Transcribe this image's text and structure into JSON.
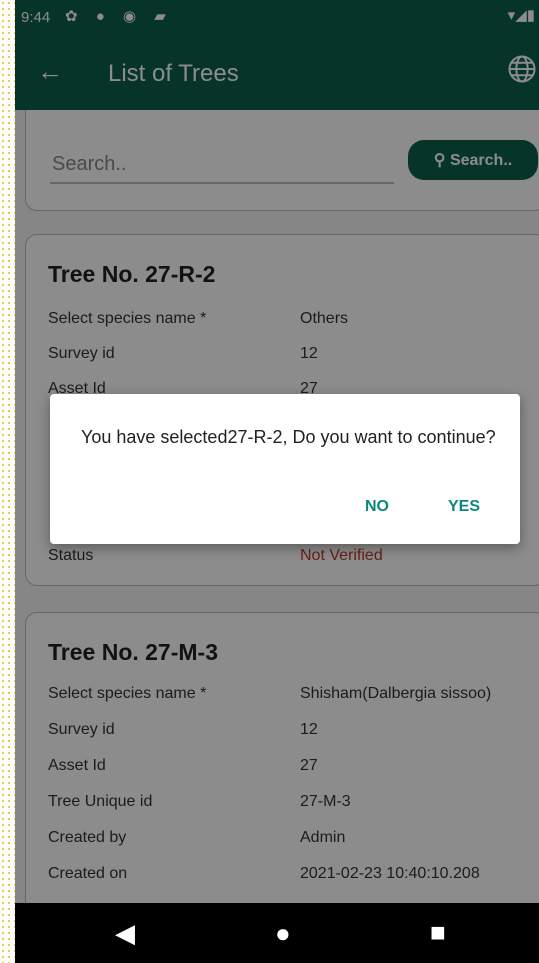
{
  "status_bar": {
    "time": "9:44",
    "icons": "✿ ● ◉ ▰",
    "right_icons": "▾◢▮"
  },
  "app_bar": {
    "back_icon": "←",
    "title": "List of Trees",
    "globe_icon": "globe-icon"
  },
  "search": {
    "placeholder": "Search..",
    "button_label": "Search.."
  },
  "cards": [
    {
      "title": "Tree No. 27-R-2",
      "rows": [
        {
          "key": "Select species name *",
          "value": "Others"
        },
        {
          "key": "Survey id",
          "value": "12"
        },
        {
          "key": "Asset Id",
          "value": "27"
        },
        {
          "key": "Status",
          "value": "Not Verified"
        }
      ]
    },
    {
      "title": "Tree No. 27-M-3",
      "rows": [
        {
          "key": "Select species name *",
          "value": "Shisham(Dalbergia sissoo)"
        },
        {
          "key": "Survey id",
          "value": "12"
        },
        {
          "key": "Asset Id",
          "value": "27"
        },
        {
          "key": "Tree Unique id",
          "value": "27-M-3"
        },
        {
          "key": "Created by",
          "value": "Admin"
        },
        {
          "key": "Created on",
          "value": "2021-02-23 10:40:10.208"
        }
      ]
    }
  ],
  "dialog": {
    "message": "You have selected27-R-2, Do you want to continue?",
    "no_label": "NO",
    "yes_label": "YES"
  },
  "nav": {
    "back": "◀",
    "home": "●",
    "recent": "■"
  },
  "colors": {
    "primary": "#0b5f4a",
    "accent": "#0a8a78",
    "status_red": "#c03a2b"
  }
}
